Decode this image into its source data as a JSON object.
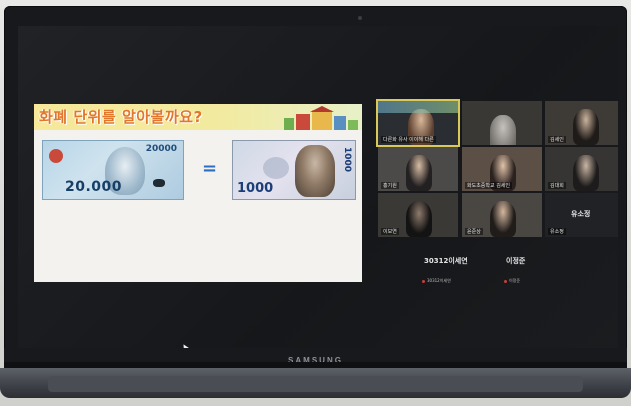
{
  "device": {
    "brand_label": "SAMSUNG"
  },
  "slide": {
    "title": "화폐 단위를 알아볼까요?",
    "vn_note": {
      "amount_main": "20.000",
      "amount_corner": "20000"
    },
    "equals_sign": "=",
    "kr_note": {
      "amount_main": "1000",
      "amount_side": "1000"
    }
  },
  "participants": [
    {
      "name": "다른화 유사 이이해 다른"
    },
    {
      "name": ""
    },
    {
      "name": "김세인"
    },
    {
      "name": "홍기원"
    },
    {
      "name": "화도초중학교 김세인"
    },
    {
      "name": "김대희"
    },
    {
      "name": "이보연"
    },
    {
      "name": "윤준상"
    },
    {
      "name": "유소정"
    }
  ],
  "empty_tiles": [
    {
      "name": "30312이세연",
      "sub": "30312이세연"
    },
    {
      "name": "이정준",
      "sub": "이정준"
    },
    {
      "name": "유소정",
      "sub": ""
    }
  ],
  "colors": {
    "title_orange": "#e2762a",
    "active_tile_outline": "#d8c95a",
    "muted_mic_red": "#d23a3a"
  }
}
